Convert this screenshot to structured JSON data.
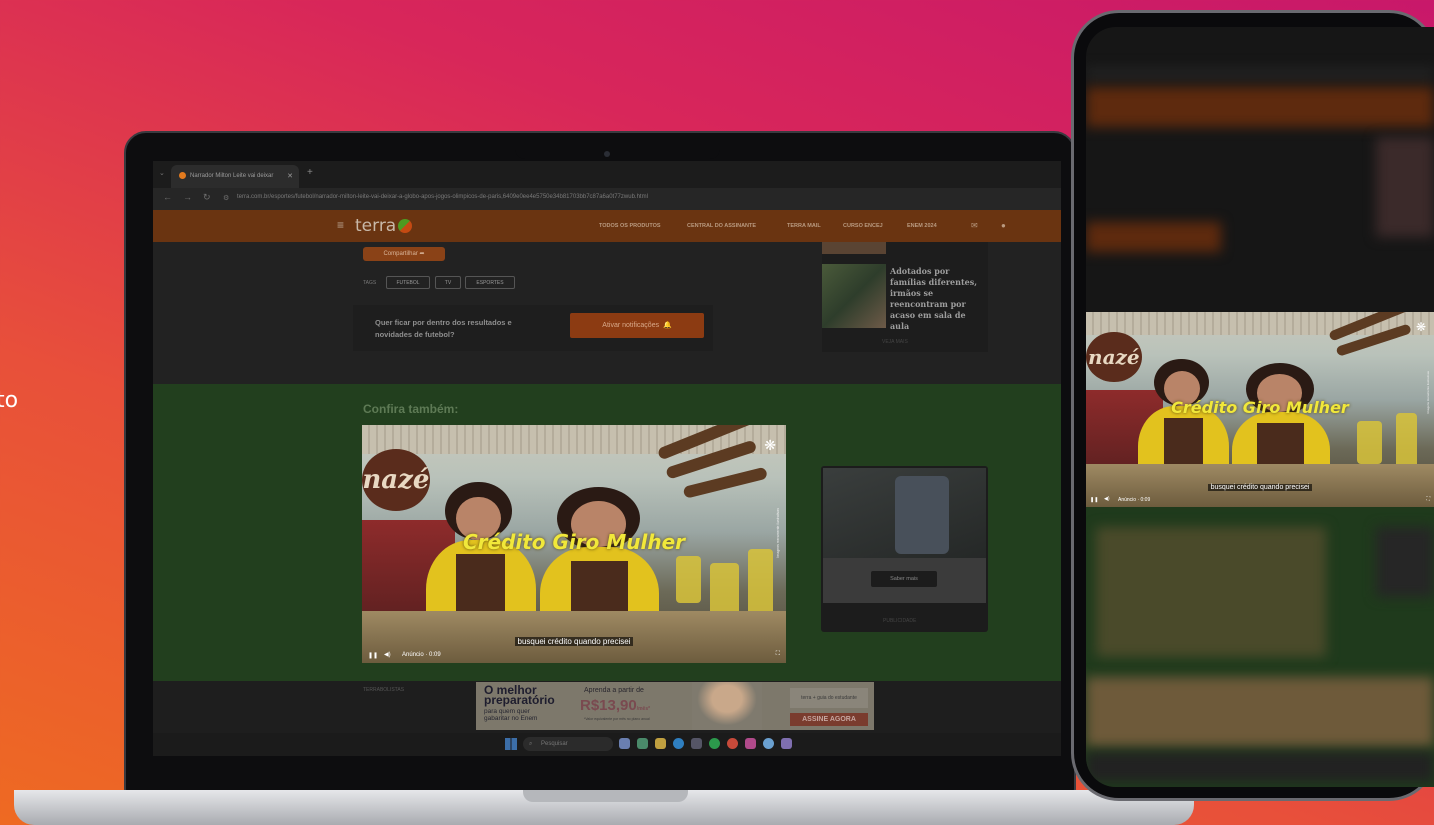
{
  "side_text": "to",
  "browser": {
    "tab_title": "Narrador Milton Leite vai deixar",
    "new_tab": "+",
    "url": "terra.com.br/esportes/futebol/narrador-milton-leite-vai-deixar-a-globo-apos-jogos-olimpicos-de-paris,6409e0ee4e5750e34b81703bb7c87a6a0t77zwub.html"
  },
  "site": {
    "logo": "terra",
    "nav": [
      "TODOS OS PRODUTOS",
      "CENTRAL DO ASSINANTE",
      "TERRA MAIL",
      "CURSO ENCEJ",
      "ENEM 2024"
    ]
  },
  "article": {
    "share_label": "Compartilhar",
    "tags_label": "TAGS",
    "tags": [
      "FUTEBOL",
      "TV",
      "ESPORTES"
    ],
    "notify_text": "Quer ficar por dentro dos resultados e novidades de futebol?",
    "notify_button": "Ativar notificações",
    "side_news_title": "Adotados por famílias diferentes, irmãos se reencontram por acaso em sala de aula",
    "side_more": "VEJA MAIS"
  },
  "confira": {
    "heading": "Confira também:"
  },
  "video": {
    "sign": "nazé",
    "title": "Crédito Giro Mulher",
    "subtitle": "busquei crédito quando precisei",
    "ad_label": "Anúncio · 0:09",
    "vertical_text": "Imagens meramente ilustrativas"
  },
  "ad_card": {
    "button": "Saber mais",
    "footer": "PUBLICIDADE"
  },
  "terra_label": "TERRABOLISTAS",
  "banner": {
    "headline": "O melhor preparatório",
    "sub": "para quem quer gabaritar no Enem",
    "from": "Aprenda a partir de",
    "price": "R$13,90",
    "price_suffix": "/mês*",
    "fine": "*Valor equivalente por mês no plano anual",
    "logo": "terra + guia do estudante",
    "cta": "ASSINE AGORA"
  },
  "taskbar": {
    "search": "Pesquisar"
  },
  "colors": {
    "background_start": "#ee6a22",
    "background_end": "#c8186a",
    "header": "#6a3411",
    "green_band": "#223f1e",
    "video_title": "#f1e83a"
  }
}
